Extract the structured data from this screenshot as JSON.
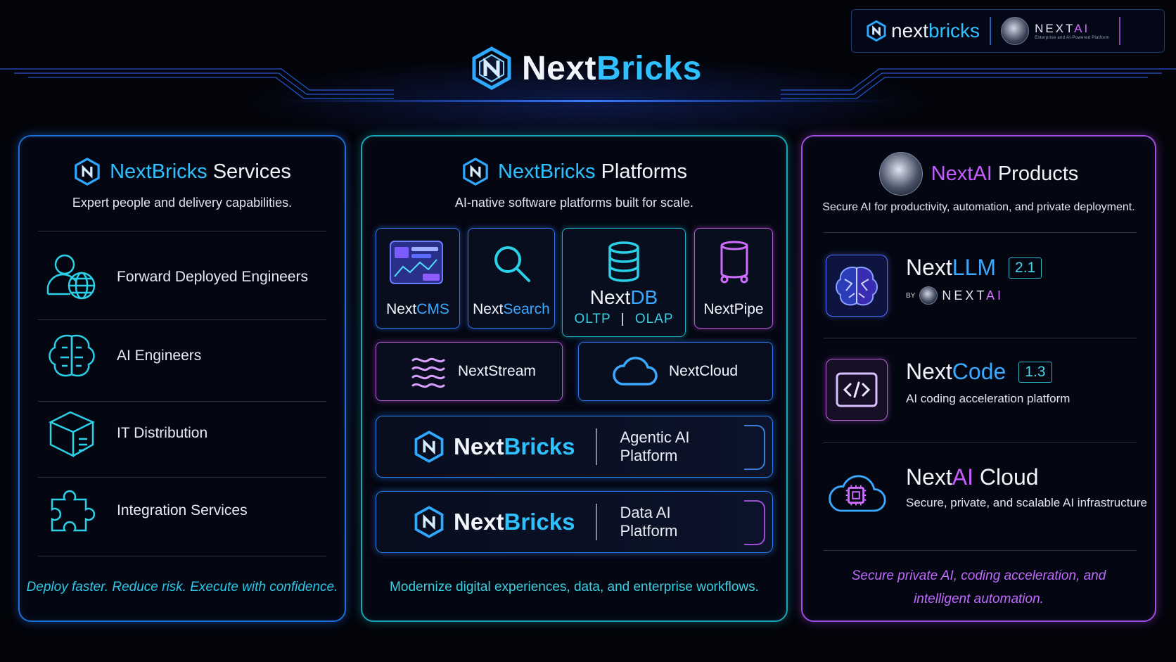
{
  "header": {
    "brand_prefix": "Next",
    "brand_suffix": "Bricks",
    "partner": {
      "nb_prefix": "next",
      "nb_suffix": "bricks",
      "nx_prefix": "NEXT",
      "nx_suffix": "AI",
      "nx_tagline": "Enterprise and AI-Powered Platform"
    }
  },
  "services": {
    "title_brand": "NextBricks",
    "title_rest": "Services",
    "subtitle": "Expert people and delivery capabilities.",
    "items": [
      {
        "label": "Forward Deployed Engineers",
        "icon": "engineer-globe-icon"
      },
      {
        "label": "AI Engineers",
        "icon": "brain-icon"
      },
      {
        "label": "IT Distribution",
        "icon": "box-icon"
      },
      {
        "label": "Integration Services",
        "icon": "puzzle-icon"
      }
    ],
    "footer": "Deploy faster. Reduce risk. Execute with confidence."
  },
  "platforms": {
    "title_brand": "NextBricks",
    "title_rest": "Platforms",
    "subtitle": "AI-native software platforms built for scale.",
    "tiles": {
      "cms": {
        "prefix": "Next",
        "suffix": "CMS"
      },
      "search": {
        "prefix": "Next",
        "suffix": "Search"
      },
      "db": {
        "prefix": "Next",
        "suffix": "DB",
        "oltp": "OLTP",
        "sep": "|",
        "olap": "OLAP"
      },
      "pipe": {
        "prefix": "Next",
        "suffix": "Pipe"
      },
      "stream": {
        "label": "NextStream"
      },
      "cloud": {
        "label": "NextCloud"
      }
    },
    "bars": [
      {
        "brand_prefix": "Next",
        "brand_suffix": "Bricks",
        "line1": "Agentic AI",
        "line2": "Platform"
      },
      {
        "brand_prefix": "Next",
        "brand_suffix": "Bricks",
        "line1": "Data AI",
        "line2": "Platform"
      }
    ],
    "footer": "Modernize digital experiences, data, and enterprise workflows."
  },
  "products": {
    "title_brand": "NextAI",
    "title_rest": "Products",
    "subtitle": "Secure AI for productivity, automation, and private deployment.",
    "llm": {
      "prefix": "Next",
      "suffix": "LLM",
      "version": "2.1",
      "by": "BY",
      "by_prefix": "NEXT",
      "by_suffix": "AI"
    },
    "code": {
      "prefix": "Next",
      "suffix": "Code",
      "version": "1.3",
      "sub": "AI coding acceleration platform"
    },
    "cloud": {
      "prefix": "Next",
      "mid": "AI",
      "suffix": " Cloud",
      "sub": "Secure, private, and scalable AI infrastructure"
    },
    "footer_line1": "Secure private AI, coding acceleration, and",
    "footer_line2": "intelligent automation."
  },
  "colors": {
    "accent_cyan": "#2fc1ff",
    "accent_purple": "#c55cff",
    "panel_blue": "#1e6fd6",
    "panel_teal": "#1aa6b8",
    "panel_purple": "#a050e0",
    "background": "#03040a"
  }
}
